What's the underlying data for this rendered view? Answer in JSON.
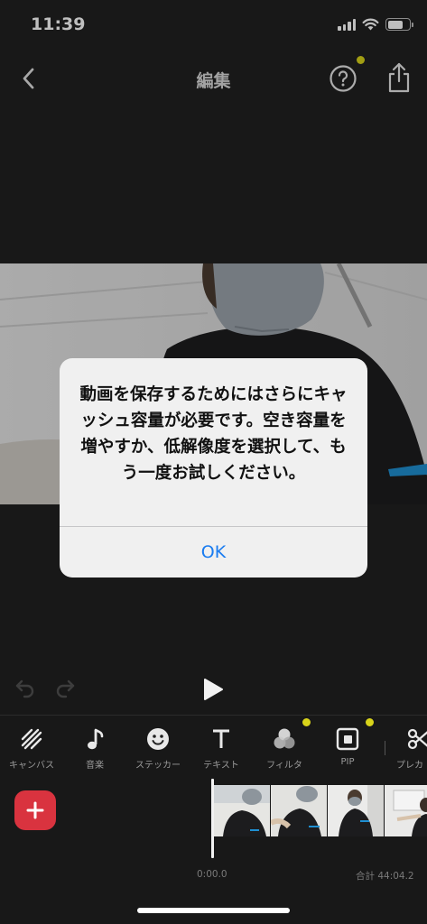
{
  "status_bar": {
    "time": "11:39"
  },
  "nav": {
    "title": "編集",
    "back_icon": "chevron-left-icon",
    "help_icon": "question-circle-icon",
    "share_icon": "share-icon"
  },
  "alert": {
    "message": "動画を保存するためにはさらにキャッシュ容量が必要です。空き容量を増やすか、低解像度を選択して、もう一度お試しください。",
    "ok_label": "OK"
  },
  "toolbar": {
    "items": [
      {
        "label": "キャンバス",
        "icon": "canvas-icon"
      },
      {
        "label": "音楽",
        "icon": "music-note-icon"
      },
      {
        "label": "ステッカー",
        "icon": "smiley-icon"
      },
      {
        "label": "テキスト",
        "icon": "text-icon"
      },
      {
        "label": "フィルタ",
        "icon": "filter-icon"
      },
      {
        "label": "PIP",
        "icon": "pip-icon"
      },
      {
        "label": "プレカ",
        "icon": "scissors-icon"
      }
    ]
  },
  "timeline": {
    "current_time": "0:00.0",
    "total_time": "合計 44:04.2"
  },
  "colors": {
    "accent_blue": "#1a7cf0",
    "add_button_red": "#d9333f",
    "badge_yellow": "#d8d31a",
    "background": "#202020"
  }
}
